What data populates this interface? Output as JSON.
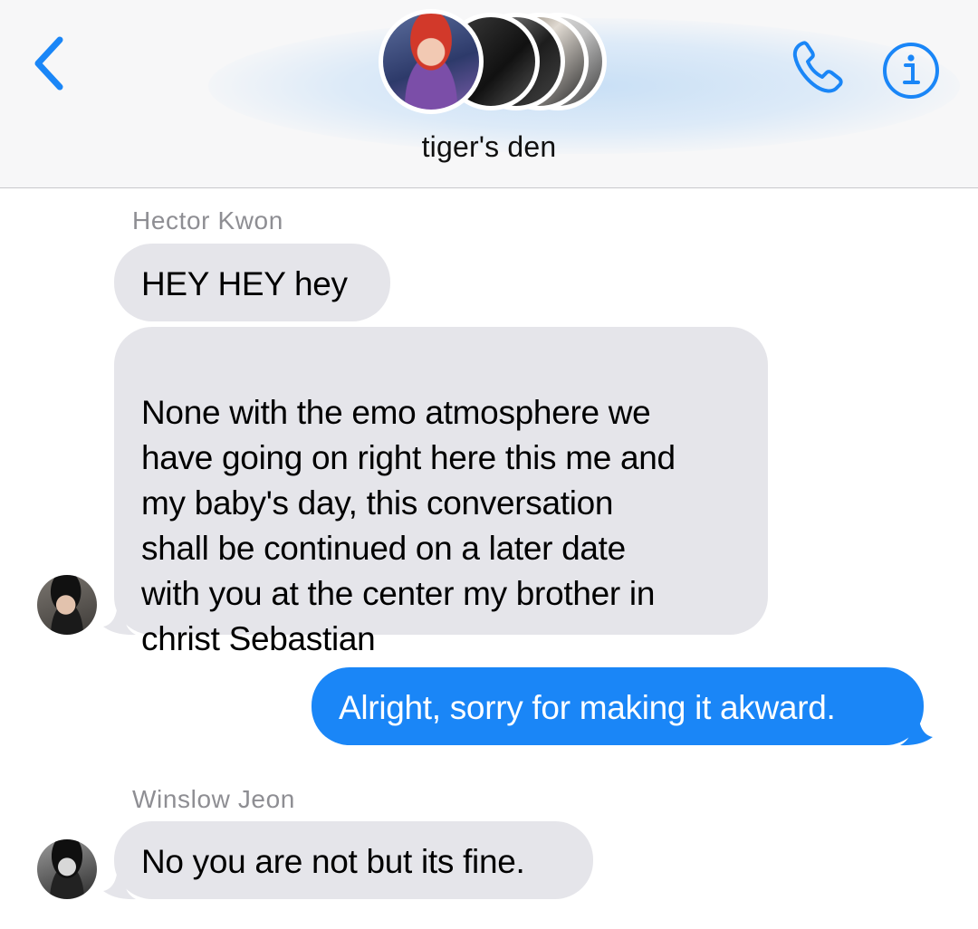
{
  "header": {
    "group_name": "tiger's den",
    "icons": {
      "back": "chevron-left-icon",
      "call": "phone-icon",
      "info": "info-icon"
    },
    "accent_color": "#1a86f7"
  },
  "messages": [
    {
      "sender": "Hector Kwon",
      "bubbles": [
        "HEY HEY hey",
        "None with the emo atmosphere we\nhave going on right here this me and\nmy baby's day, this conversation\nshall be continued on a later date\nwith you at the center my brother in\nchrist Sebastian"
      ]
    },
    {
      "sender": "me",
      "bubbles": [
        "Alright, sorry for making it akward."
      ]
    },
    {
      "sender": "Winslow Jeon",
      "bubbles": [
        "No you are not but its fine."
      ]
    }
  ],
  "colors": {
    "incoming_bubble": "#e5e5ea",
    "outgoing_bubble": "#1a86f7",
    "sender_name": "#8e8e93"
  }
}
